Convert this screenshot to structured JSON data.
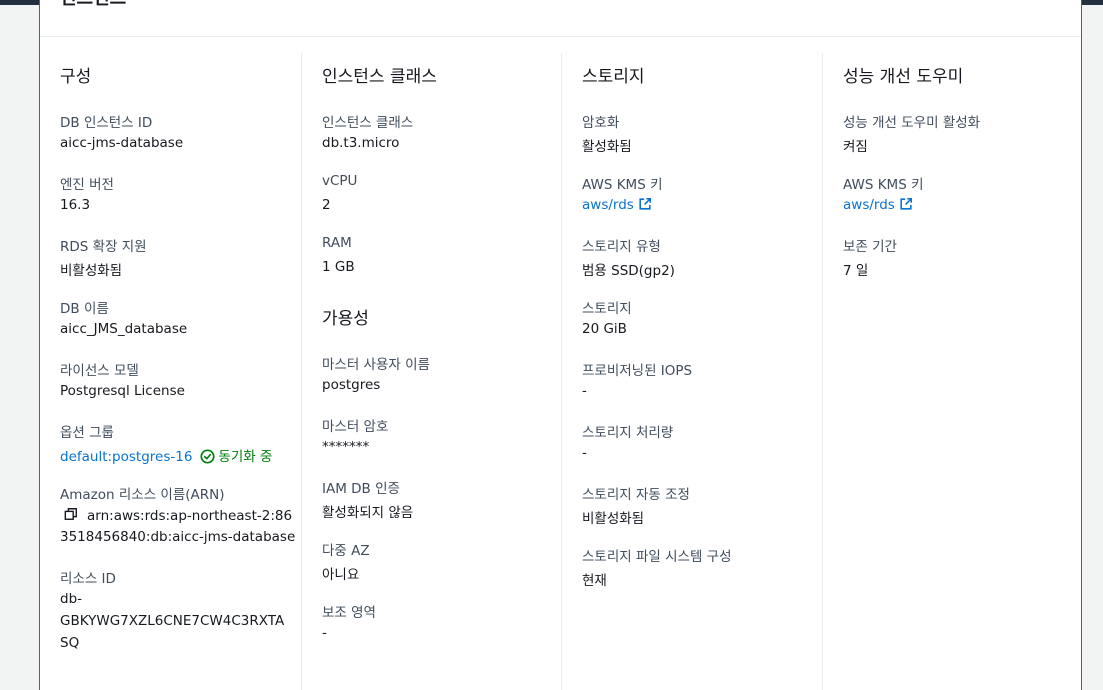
{
  "panel": {
    "title": "인스턴스"
  },
  "configuration": {
    "title": "구성",
    "db_instance_id_label": "DB 인스턴스 ID",
    "db_instance_id": "aicc-jms-database",
    "engine_version_label": "엔진 버전",
    "engine_version": "16.3",
    "rds_extended_support_label": "RDS 확장 지원",
    "rds_extended_support": "비활성화됨",
    "db_name_label": "DB 이름",
    "db_name": "aicc_JMS_database",
    "license_model_label": "라이선스 모델",
    "license_model": "Postgresql License",
    "option_group_label": "옵션 그룹",
    "option_group": "default:postgres-16",
    "option_group_status": "동기화 중",
    "arn_label": "Amazon 리소스 이름(ARN)",
    "arn_line1": "arn:aws:rds:ap-northeast-2:86",
    "arn_line2": "3518456840:db:aicc-jms-database",
    "resource_id_label": "리소스 ID",
    "resource_id_line1": "db-",
    "resource_id_line2": "GBKYWG7XZL6CNE7CW4C3RXTA",
    "resource_id_line3": "SQ"
  },
  "instance_class": {
    "title": "인스턴스 클래스",
    "class_label": "인스턴스 클래스",
    "class": "db.t3.micro",
    "vcpu_label": "vCPU",
    "vcpu": "2",
    "ram_label": "RAM",
    "ram": "1 GB"
  },
  "availability": {
    "title": "가용성",
    "master_user_label": "마스터 사용자 이름",
    "master_user": "postgres",
    "master_password_label": "마스터 암호",
    "master_password": "*******",
    "iam_auth_label": "IAM DB 인증",
    "iam_auth": "활성화되지 않음",
    "multi_az_label": "다중 AZ",
    "multi_az": "아니요",
    "secondary_zone_label": "보조 영역",
    "secondary_zone": "-"
  },
  "storage": {
    "title": "스토리지",
    "encryption_label": "암호화",
    "encryption": "활성화됨",
    "kms_key_label": "AWS KMS 키",
    "kms_key": "aws/rds",
    "storage_type_label": "스토리지 유형",
    "storage_type": "범용 SSD(gp2)",
    "storage_label": "스토리지",
    "storage": "20 GiB",
    "iops_label": "프로비저닝된 IOPS",
    "iops": "-",
    "throughput_label": "스토리지 처리량",
    "throughput": "-",
    "autoscaling_label": "스토리지 자동 조정",
    "autoscaling": "비활성화됨",
    "filesystem_label": "스토리지 파일 시스템 구성",
    "filesystem": "현재"
  },
  "performance_insights": {
    "title": "성능 개선 도우미",
    "enabled_label": "성능 개선 도우미 활성화",
    "enabled": "켜짐",
    "kms_key_label": "AWS KMS 키",
    "kms_key": "aws/rds",
    "retention_label": "보존 기간",
    "retention": "7 일"
  },
  "colors": {
    "link": "#0972d3",
    "success": "#037f0c",
    "border_accent": "#0972d3",
    "topbar": "#232f3e"
  },
  "icons": [
    "external-link-icon",
    "status-success-icon",
    "copy-icon"
  ]
}
